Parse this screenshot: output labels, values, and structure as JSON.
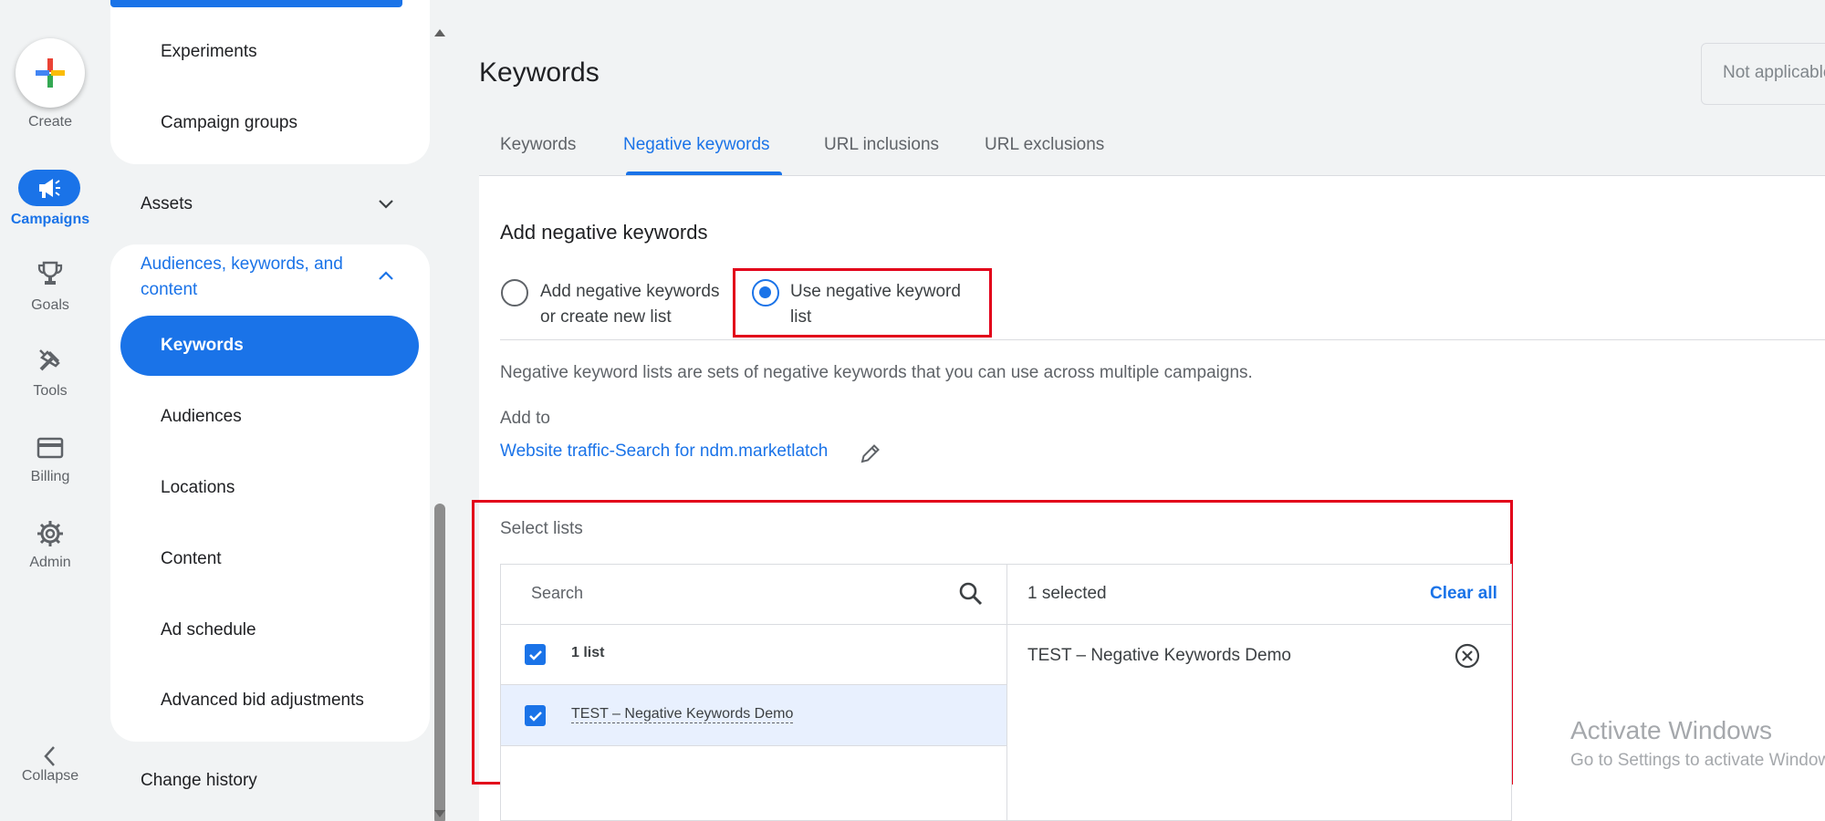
{
  "rail": {
    "create_label": "Create",
    "items": [
      {
        "label": "Campaigns",
        "icon": "megaphone-icon",
        "active": true
      },
      {
        "label": "Goals",
        "icon": "trophy-icon"
      },
      {
        "label": "Tools",
        "icon": "tools-icon"
      },
      {
        "label": "Billing",
        "icon": "credit-card-icon"
      },
      {
        "label": "Admin",
        "icon": "gear-icon"
      }
    ],
    "collapse_label": "Collapse"
  },
  "nav": {
    "experiments": "Experiments",
    "campaign_groups": "Campaign groups",
    "assets": "Assets",
    "audiences_section": "Audiences, keywords, and content",
    "audiences_section_line1": "Audiences, keywords, and",
    "audiences_section_line2": "content",
    "keywords": "Keywords",
    "audiences": "Audiences",
    "locations": "Locations",
    "content": "Content",
    "ad_schedule": "Ad schedule",
    "advanced_bid": "Advanced bid adjustments",
    "change_history": "Change history"
  },
  "header": {
    "title": "Keywords",
    "top_right": "Not applicable"
  },
  "tabs": [
    {
      "label": "Keywords",
      "active": false
    },
    {
      "label": "Negative keywords",
      "active": true
    },
    {
      "label": "URL inclusions",
      "active": false
    },
    {
      "label": "URL exclusions",
      "active": false
    }
  ],
  "form": {
    "section_title": "Add negative keywords",
    "option1_line1": "Add negative keywords",
    "option1_line2": "or create new list",
    "option2_line1": "Use negative keyword",
    "option2_line2": "list",
    "selected_option": "option2",
    "description": "Negative keyword lists are sets of negative keywords that you can use across multiple campaigns.",
    "add_to_label": "Add to",
    "campaign_link": "Website traffic-Search for ndm.marketlatch",
    "select_lists_label": "Select lists"
  },
  "list_picker": {
    "search_placeholder": "Search",
    "count_label": "1 list",
    "rows": [
      {
        "label": "TEST – Negative Keywords Demo",
        "checked": true
      }
    ],
    "selected_count": "1 selected",
    "clear_all": "Clear all",
    "selected_items": [
      "TEST – Negative Keywords Demo"
    ]
  },
  "watermark": {
    "line1": "Activate Windows",
    "line2": "Go to Settings to activate Windows."
  },
  "colors": {
    "accent": "#1a73e8",
    "highlight_box": "#e2001a",
    "background": "#f1f3f4"
  }
}
